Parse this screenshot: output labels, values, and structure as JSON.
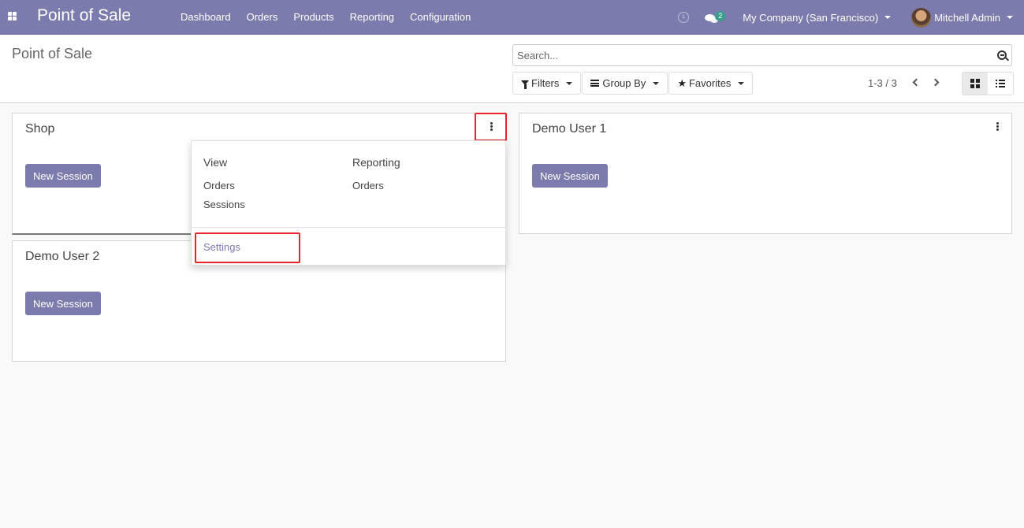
{
  "navbar": {
    "app_title": "Point of Sale",
    "menu": [
      "Dashboard",
      "Orders",
      "Products",
      "Reporting",
      "Configuration"
    ],
    "messages_count": "2",
    "company": "My Company (San Francisco)",
    "user": "Mitchell Admin"
  },
  "control_panel": {
    "breadcrumb": "Point of Sale",
    "search_placeholder": "Search...",
    "filters_label": "Filters",
    "group_by_label": "Group By",
    "favorites_label": "Favorites",
    "pager": "1-3 / 3",
    "active_view": "kanban"
  },
  "cards": [
    {
      "title": "Shop",
      "button": "New Session"
    },
    {
      "title": "Demo User 1",
      "button": "New Session"
    },
    {
      "title": "Demo User 2",
      "button": "New Session"
    }
  ],
  "dropdown": {
    "view_header": "View",
    "view_items": [
      "Orders",
      "Sessions"
    ],
    "reporting_header": "Reporting",
    "reporting_items": [
      "Orders"
    ],
    "settings": "Settings"
  },
  "colors": {
    "brand": "#7c7bad",
    "highlight": "#e8232b",
    "badge": "#3a9e8a"
  }
}
